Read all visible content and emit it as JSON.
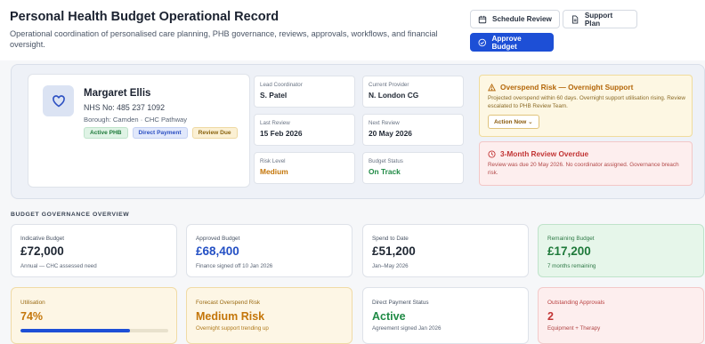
{
  "header": {
    "title": "Personal Health Budget Operational Record",
    "subtitle": "Operational coordination of personalised care planning, PHB governance, reviews, approvals, workflows, and financial oversight.",
    "buttons": {
      "schedule_review": "Schedule Review",
      "support_plan": "Support Plan",
      "approve_budget": "Approve Budget"
    }
  },
  "patient": {
    "name": "Margaret Ellis",
    "nhs": "NHS No: 485 237 1092",
    "borough": "Borough: Camden · CHC Pathway",
    "badges": [
      "Active PHB",
      "Direct Payment",
      "Review Due"
    ],
    "info": {
      "lead_coordinator": {
        "label": "Lead Coordinator",
        "value": "S. Patel"
      },
      "current_provider": {
        "label": "Current Provider",
        "value": "N. London CG"
      },
      "last_review": {
        "label": "Last Review",
        "value": "15 Feb 2026"
      },
      "next_review": {
        "label": "Next Review",
        "value": "20 May 2026"
      },
      "risk_level": {
        "label": "Risk Level",
        "value": "Medium"
      },
      "budget_status": {
        "label": "Budget Status",
        "value": "On Track"
      }
    }
  },
  "alerts": {
    "overspend": {
      "title": "Overspend Risk — Overnight Support",
      "text": "Projected overspend within 60 days. Overnight support utilisation rising. Review escalated to PHB Review Team.",
      "action": "Action Now ⌄"
    },
    "review_overdue": {
      "title": "3-Month Review Overdue",
      "text": "Review was due 20 May 2026. No coordinator assigned. Governance breach risk."
    }
  },
  "overview": {
    "section_title": "BUDGET GOVERNANCE OVERVIEW",
    "cards": {
      "indicative": {
        "label": "Indicative Budget",
        "value": "£72,000",
        "sub": "Annual — CHC assessed need"
      },
      "approved": {
        "label": "Approved Budget",
        "value": "£68,400",
        "sub": "Finance signed off 10 Jan 2026"
      },
      "spend": {
        "label": "Spend to Date",
        "value": "£51,200",
        "sub": "Jan–May 2026"
      },
      "remaining": {
        "label": "Remaining Budget",
        "value": "£17,200",
        "sub": "7 months remaining"
      },
      "utilisation": {
        "label": "Utilisation",
        "value": "74%",
        "progress": 0.74
      },
      "forecast": {
        "label": "Forecast Overspend Risk",
        "value": "Medium Risk",
        "sub": "Overnight support trending up"
      },
      "direct_payment": {
        "label": "Direct Payment Status",
        "value": "Active",
        "sub": "Agreement signed Jan 2026"
      },
      "approvals": {
        "label": "Outstanding Approvals",
        "value": "2",
        "sub": "Equipment + Therapy"
      }
    }
  },
  "colors": {
    "primary": "#1d4fd6",
    "success": "#1f8a45",
    "warning": "#c4760a",
    "danger": "#c23535"
  },
  "icons": {
    "schedule": "calendar-icon",
    "support": "document-icon",
    "approve": "check-circle-icon",
    "avatar": "heart-icon",
    "warning": "warning-icon",
    "clock": "clock-icon"
  }
}
